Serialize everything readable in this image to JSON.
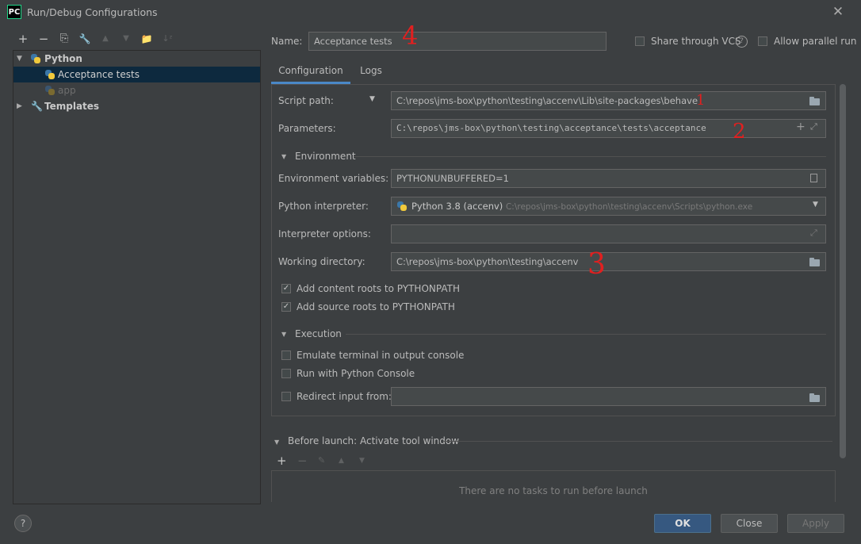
{
  "window": {
    "title": "Run/Debug Configurations",
    "logo_text": "PC"
  },
  "left_toolbar": [
    "+",
    "−",
    "⎘",
    "🔧",
    "▲",
    "▼",
    "📁",
    "↓ᶻ"
  ],
  "tree": {
    "python_group": "Python",
    "items": [
      "Acceptance tests",
      "app"
    ],
    "templates": "Templates"
  },
  "name_row": {
    "label": "Name:",
    "value": "Acceptance tests"
  },
  "share_vcs": "Share through VCS",
  "allow_parallel": "Allow parallel run",
  "tabs": [
    "Configuration",
    "Logs"
  ],
  "form": {
    "script_path_label": "Script path:",
    "script_path_value": "C:\\repos\\jms-box\\python\\testing\\accenv\\Lib\\site-packages\\behave",
    "parameters_label": "Parameters:",
    "parameters_value": "C:\\repos\\jms-box\\python\\testing\\acceptance\\tests\\acceptance",
    "environment_section": "Environment",
    "env_vars_label": "Environment variables:",
    "env_vars_value": "PYTHONUNBUFFERED=1",
    "interpreter_label": "Python interpreter:",
    "interpreter_name": "Python 3.8 (accenv)",
    "interpreter_path": "C:\\repos\\jms-box\\python\\testing\\accenv\\Scripts\\python.exe",
    "interp_options_label": "Interpreter options:",
    "interp_options_value": "",
    "working_dir_label": "Working directory:",
    "working_dir_value": "C:\\repos\\jms-box\\python\\testing\\accenv",
    "add_content_roots": "Add content roots to PYTHONPATH",
    "add_source_roots": "Add source roots to PYTHONPATH",
    "execution_section": "Execution",
    "emulate_terminal": "Emulate terminal in output console",
    "run_python_console": "Run with Python Console",
    "redirect_input": "Redirect input from:",
    "redirect_value": ""
  },
  "before_launch": {
    "title": "Before launch: Activate tool window",
    "empty_text": "There are no tasks to run before launch"
  },
  "buttons": {
    "ok": "OK",
    "close": "Close",
    "apply": "Apply",
    "help": "?"
  },
  "annotations": [
    "1",
    "2",
    "3",
    "4"
  ],
  "colors": {
    "selection": "#0d293e",
    "ok_button": "#365880",
    "annotation": "#e02020"
  }
}
